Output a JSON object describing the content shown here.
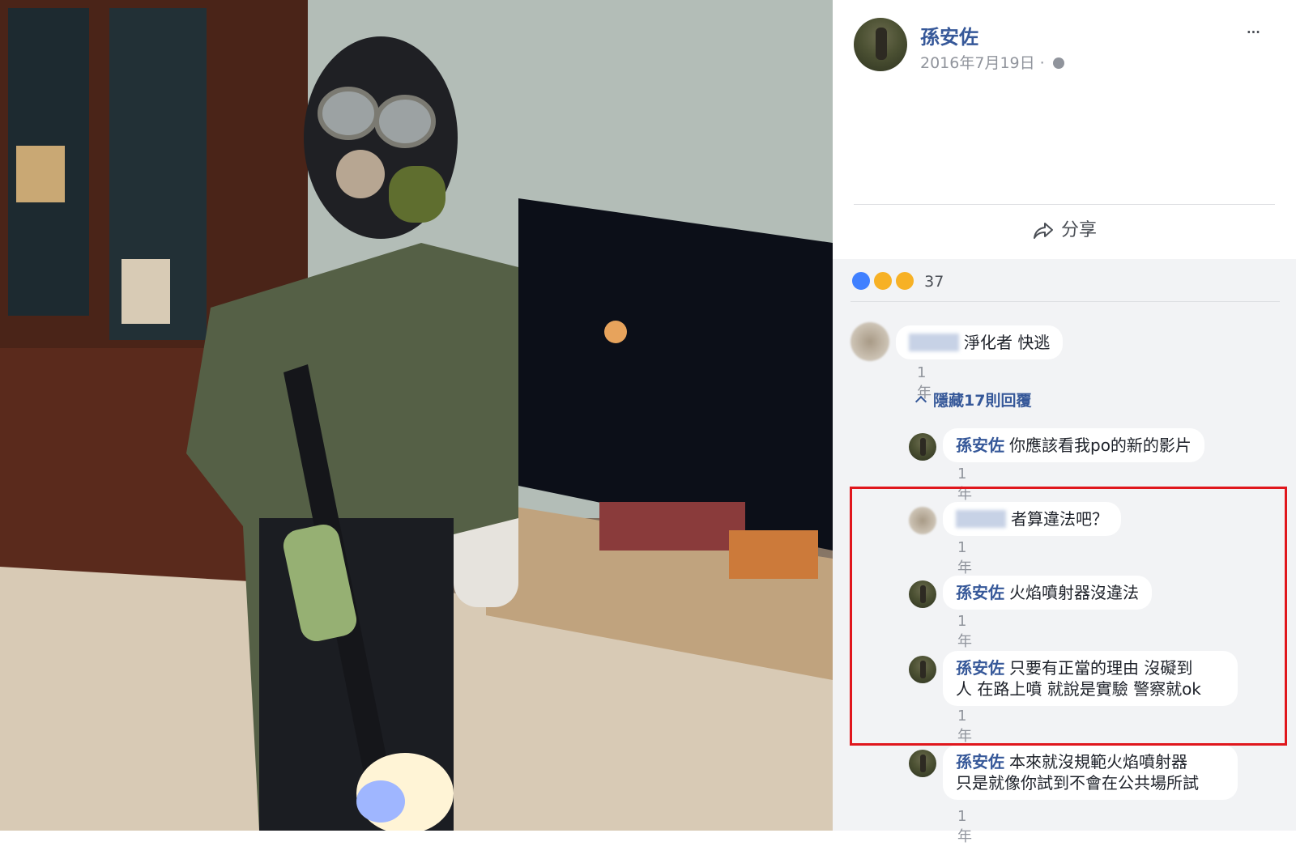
{
  "post": {
    "author": "孫安佐",
    "date": "2016年7月19日",
    "separator": "·",
    "more": "···",
    "share_label": "分享"
  },
  "reactions": {
    "icons": [
      "like-icon",
      "haha-icon",
      "wow-icon"
    ],
    "count": "37"
  },
  "comments": [
    {
      "name": "",
      "text": "淨化者 快逃",
      "time": "1年",
      "name_blurred": true
    },
    {
      "name": "孫安佐",
      "text": "你應該看我po的新的影片",
      "time": "1年"
    },
    {
      "name": "",
      "text": "者算違法吧？",
      "time": "1年",
      "name_blurred": true
    },
    {
      "name": "孫安佐",
      "text": "火焰噴射器沒違法",
      "time": "1年"
    },
    {
      "name": "孫安佐",
      "text_line1": "只要有正當的理由 沒礙到",
      "text_line2": "人 在路上噴 就說是實驗 警察就ok",
      "time": "1年"
    },
    {
      "name": "孫安佐",
      "text_line1": "本來就沒規範火焰噴射器",
      "text_line2": "只是就像你試到不會在公共場所試",
      "time": "1年"
    }
  ],
  "hide_replies": "隱藏17則回覆",
  "colors": {
    "link": "#365899",
    "comment_bg": "#f2f3f5",
    "highlight": "#e0161c"
  }
}
